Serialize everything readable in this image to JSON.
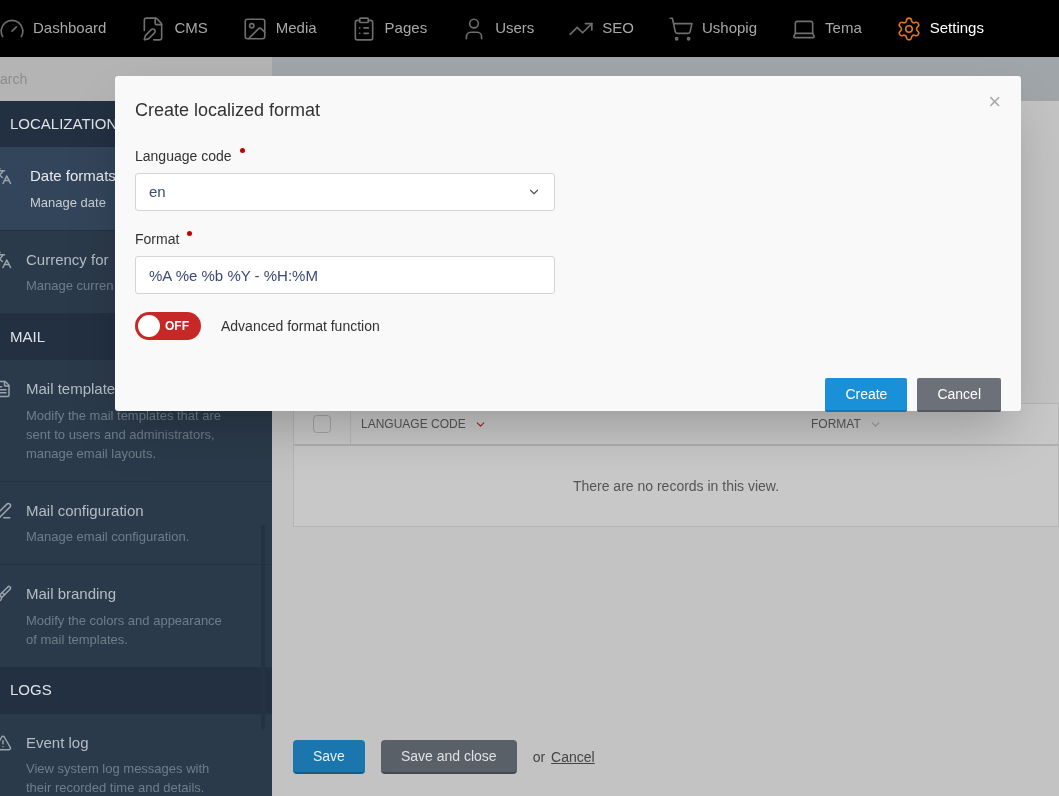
{
  "nav": {
    "items": [
      {
        "label": "Dashboard",
        "selected": false
      },
      {
        "label": "CMS",
        "selected": false
      },
      {
        "label": "Media",
        "selected": false
      },
      {
        "label": "Pages",
        "selected": false
      },
      {
        "label": "Users",
        "selected": false
      },
      {
        "label": "SEO",
        "selected": false
      },
      {
        "label": "Ushopig",
        "selected": false
      },
      {
        "label": "Tema",
        "selected": false
      },
      {
        "label": "Settings",
        "selected": true
      }
    ]
  },
  "sidebar": {
    "search": {
      "placeholder": "arch"
    },
    "sections": [
      {
        "title": "LOCALIZATION",
        "items": [
          {
            "title": "Date formats",
            "description": "Manage date",
            "selected": true
          },
          {
            "title": "Currency for",
            "description": "Manage curren",
            "selected": false
          }
        ]
      },
      {
        "title": "MAIL",
        "items": [
          {
            "title": "Mail template",
            "description": "Modify the mail templates that are sent to users and administrators, manage email layouts.",
            "selected": false
          },
          {
            "title": "Mail configuration",
            "description": "Manage email configuration.",
            "selected": false
          },
          {
            "title": "Mail branding",
            "description": "Modify the colors and appearance of mail templates.",
            "selected": false
          }
        ]
      },
      {
        "title": "LOGS",
        "items": [
          {
            "title": "Event log",
            "description": "View system log messages with their recorded time and details.",
            "selected": false
          }
        ]
      }
    ]
  },
  "table": {
    "select_all": {
      "checked": false
    },
    "columns": [
      {
        "label": "LANGUAGE CODE",
        "sorted": true
      },
      {
        "label": "FORMAT",
        "sorted": false
      }
    ],
    "empty_message": "There are no records in this view."
  },
  "footer": {
    "buttons": [
      {
        "label": "Save",
        "kind": "primary"
      },
      {
        "label": "Save and close",
        "kind": "secondary"
      }
    ],
    "or_text": "or",
    "cancel_link": "Cancel"
  },
  "modal": {
    "title": "Create localized format",
    "close": "×",
    "fields": [
      {
        "label": "Language code",
        "required": true,
        "kind": "select",
        "value": "en"
      },
      {
        "label": "Format",
        "required": true,
        "kind": "text",
        "value": "%A %e %b %Y - %H:%M"
      }
    ],
    "toggle": {
      "on": false,
      "state_label": "OFF",
      "label": "Advanced format function"
    },
    "buttons": [
      {
        "label": "Create",
        "kind": "primary"
      },
      {
        "label": "Cancel",
        "kind": "secondary"
      }
    ]
  }
}
